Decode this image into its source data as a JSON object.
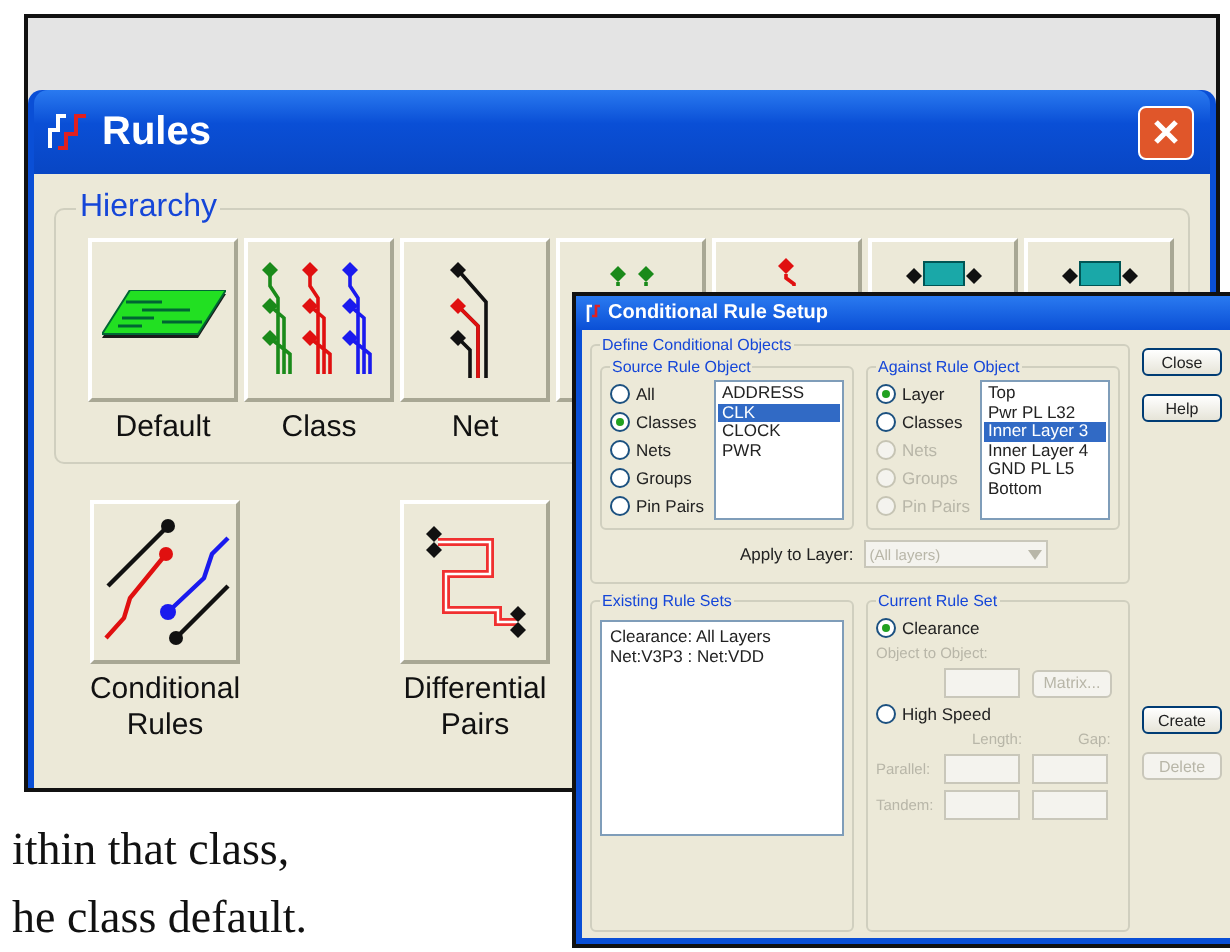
{
  "rules_window": {
    "title": "Rules",
    "hierarchy": {
      "title": "Hierarchy",
      "buttons": [
        {
          "label": "Default",
          "kind": "board"
        },
        {
          "label": "Class",
          "kind": "class"
        },
        {
          "label": "Net",
          "kind": "net"
        },
        {
          "kind": "pin-pair"
        },
        {
          "kind": "pin"
        },
        {
          "kind": "chip"
        },
        {
          "kind": "chip"
        }
      ]
    },
    "extra_buttons": [
      {
        "label": "Conditional Rules",
        "kind": "conditional"
      },
      {
        "label": "Differential Pairs",
        "kind": "differential"
      }
    ]
  },
  "dialog": {
    "title": "Conditional Rule Setup",
    "define_group": {
      "title": "Define Conditional Objects",
      "source": {
        "title": "Source Rule Object",
        "options": [
          {
            "label": "All",
            "selected": false,
            "disabled": false
          },
          {
            "label": "Classes",
            "selected": true,
            "disabled": false
          },
          {
            "label": "Nets",
            "selected": false,
            "disabled": false
          },
          {
            "label": "Groups",
            "selected": false,
            "disabled": false
          },
          {
            "label": "Pin Pairs",
            "selected": false,
            "disabled": false
          }
        ],
        "list": [
          {
            "text": "ADDRESS",
            "selected": false
          },
          {
            "text": "CLK",
            "selected": true
          },
          {
            "text": "CLOCK",
            "selected": false
          },
          {
            "text": "PWR",
            "selected": false
          }
        ]
      },
      "against": {
        "title": "Against Rule Object",
        "options": [
          {
            "label": "Layer",
            "selected": true,
            "disabled": false
          },
          {
            "label": "Classes",
            "selected": false,
            "disabled": false
          },
          {
            "label": "Nets",
            "selected": false,
            "disabled": true
          },
          {
            "label": "Groups",
            "selected": false,
            "disabled": true
          },
          {
            "label": "Pin Pairs",
            "selected": false,
            "disabled": true
          }
        ],
        "list": [
          {
            "text": "Top",
            "selected": false
          },
          {
            "text": "Pwr PL L32",
            "selected": false
          },
          {
            "text": "Inner Layer 3",
            "selected": true
          },
          {
            "text": "Inner Layer 4",
            "selected": false
          },
          {
            "text": "GND PL L5",
            "selected": false
          },
          {
            "text": "Bottom",
            "selected": false
          }
        ]
      },
      "apply_to_layer": {
        "label": "Apply to Layer:",
        "value": "(All layers)",
        "disabled": true
      }
    },
    "side_buttons": [
      {
        "label": "Close",
        "disabled": false
      },
      {
        "label": "Help",
        "disabled": false
      }
    ],
    "existing": {
      "title": "Existing Rule Sets",
      "items": [
        "Clearance: All Layers",
        "Net:V3P3 : Net:VDD"
      ]
    },
    "current": {
      "title": "Current Rule Set",
      "clearance": {
        "label": "Clearance",
        "selected": true,
        "disabled": false
      },
      "object_to_object": {
        "label": "Object to Object:",
        "disabled": true
      },
      "matrix_button": {
        "label": "Matrix...",
        "disabled": true
      },
      "high_speed": {
        "label": "High Speed",
        "selected": false,
        "disabled": false
      },
      "length_label": "Length:",
      "gap_label": "Gap:",
      "rows": [
        {
          "label": "Parallel:"
        },
        {
          "label": "Tandem:"
        }
      ]
    },
    "action_buttons": [
      {
        "label": "Create",
        "disabled": false
      },
      {
        "label": "Delete",
        "disabled": true
      }
    ]
  },
  "caption": [
    "ithin that class,",
    "he class default."
  ]
}
